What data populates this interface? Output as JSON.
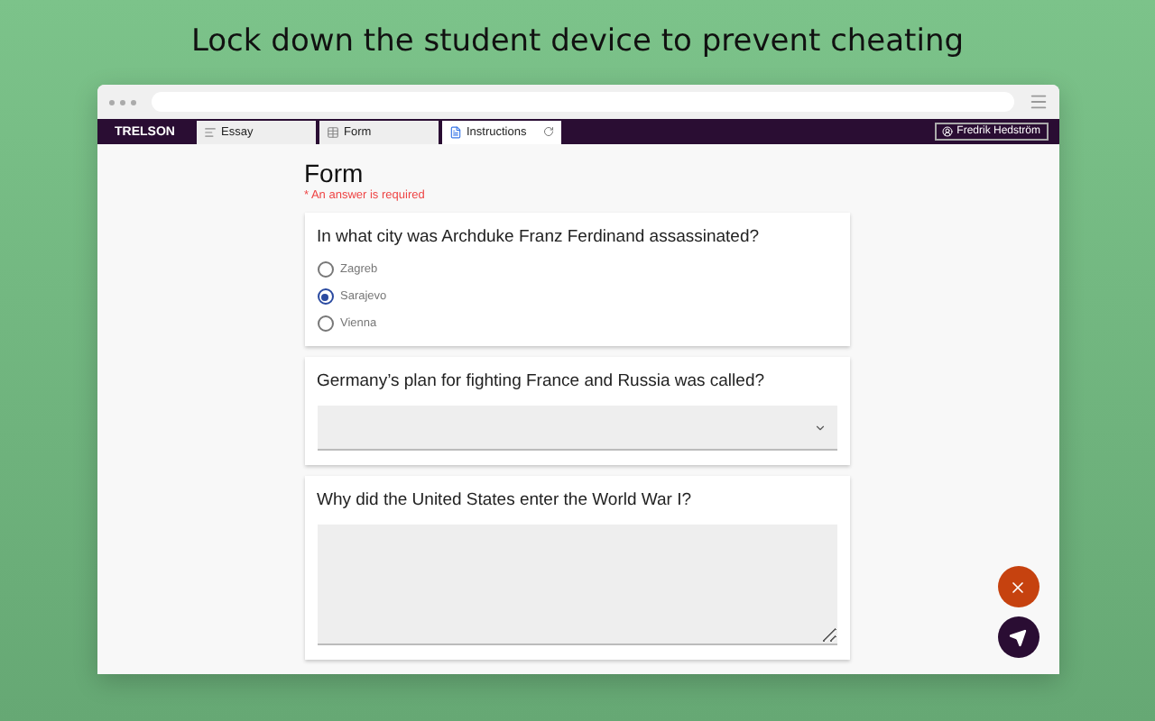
{
  "headline": "Lock down the student device to prevent cheating",
  "app_bar": {
    "logo": "TRELSON",
    "tabs": [
      {
        "label": "Essay",
        "kind": "text",
        "selected": false
      },
      {
        "label": "Form",
        "kind": "form",
        "selected": false
      },
      {
        "label": "Instructions",
        "kind": "document",
        "selected": true
      }
    ],
    "user": "Fredrik Hedström"
  },
  "form": {
    "title": "Form",
    "required_note": "* An answer is required",
    "questions": [
      {
        "kind": "radio",
        "text": "In what city was Archduke Franz Ferdinand assassinated?",
        "options": [
          {
            "label": "Zagreb",
            "selected": false
          },
          {
            "label": "Sarajevo",
            "selected": true
          },
          {
            "label": "Vienna",
            "selected": false
          }
        ]
      },
      {
        "kind": "select",
        "text": "Germany’s plan for fighting France and Russia was called?"
      },
      {
        "kind": "textarea",
        "text": "Why did the United States enter the World War I?"
      }
    ]
  }
}
